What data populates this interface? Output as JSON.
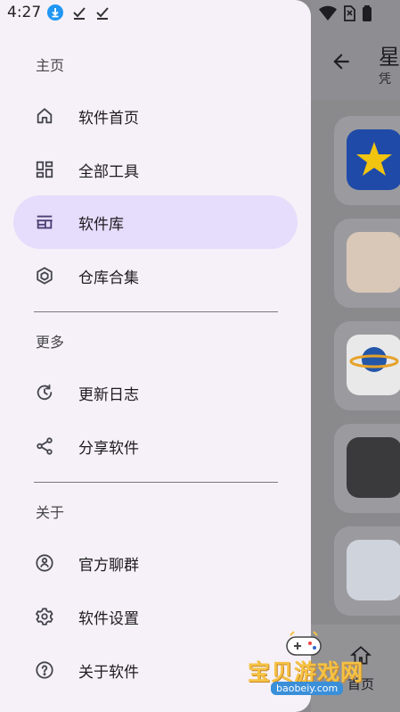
{
  "status_bar": {
    "time": "4:27",
    "left_icons": [
      "download-icon",
      "check-icon",
      "check-icon"
    ],
    "right_icons": [
      "wifi-icon",
      "no-sim-icon",
      "battery-icon"
    ]
  },
  "background_app": {
    "title": "星",
    "subtitle": "凭",
    "bottom_nav_label": "首页"
  },
  "drawer": {
    "sections": [
      {
        "header": "主页",
        "items": [
          {
            "label": "软件首页",
            "icon": "home-icon",
            "active": false
          },
          {
            "label": "全部工具",
            "icon": "grid-icon",
            "active": false
          },
          {
            "label": "软件库",
            "icon": "store-icon",
            "active": true
          },
          {
            "label": "仓库合集",
            "icon": "cube-icon",
            "active": false
          }
        ]
      },
      {
        "header": "更多",
        "items": [
          {
            "label": "更新日志",
            "icon": "history-icon",
            "active": false
          },
          {
            "label": "分享软件",
            "icon": "share-icon",
            "active": false
          }
        ]
      },
      {
        "header": "关于",
        "items": [
          {
            "label": "官方聊群",
            "icon": "group-icon",
            "active": false
          },
          {
            "label": "软件设置",
            "icon": "gear-icon",
            "active": false
          },
          {
            "label": "关于软件",
            "icon": "help-icon",
            "active": false
          }
        ]
      }
    ]
  },
  "watermark": {
    "text": "宝贝游戏网",
    "url": "baobeiy.com"
  },
  "colors": {
    "drawer_bg": "#f6f1f8",
    "active_bg": "#e6dcfb",
    "scrim": "#8a8a8d"
  }
}
